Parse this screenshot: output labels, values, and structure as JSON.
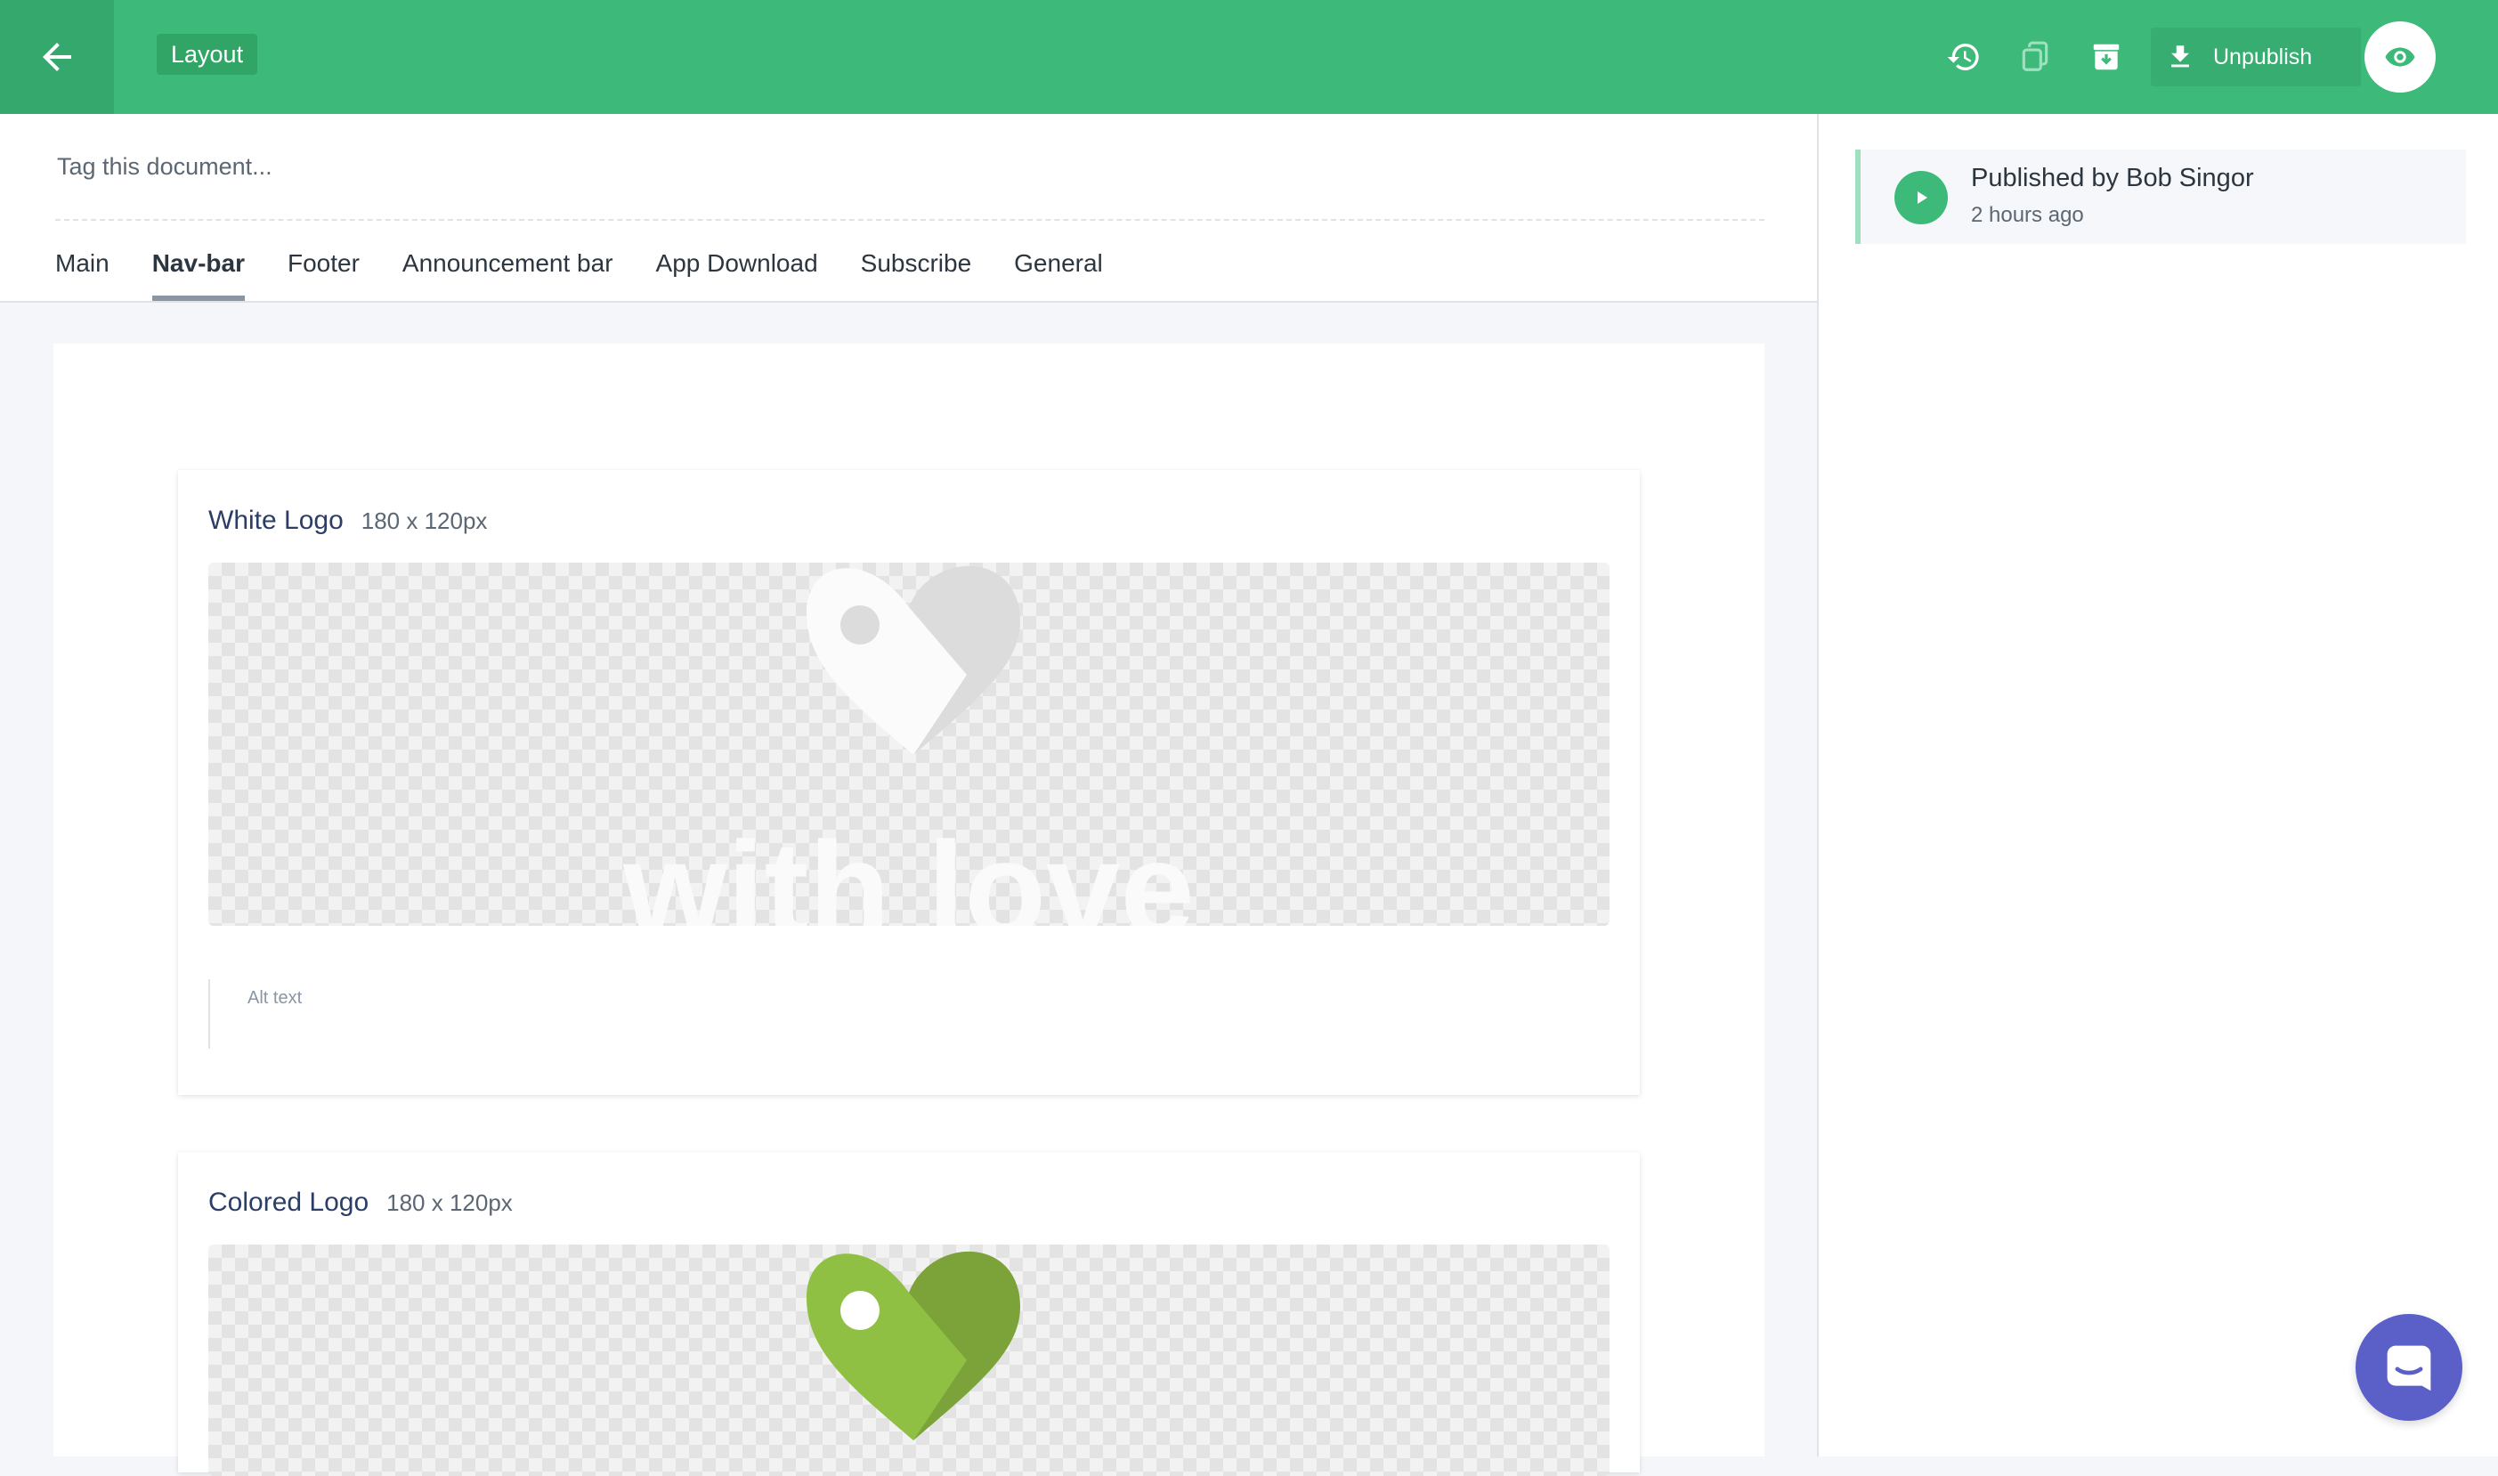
{
  "header": {
    "doc_type": "Layout",
    "actions": {
      "history_icon": "history-icon",
      "duplicate_icon": "copy-icon",
      "archive_icon": "archive-icon",
      "unpublish_label": "Unpublish",
      "preview_icon": "eye-icon"
    },
    "accent_color": "#3db97a"
  },
  "editor": {
    "tag_placeholder": "Tag this document...",
    "tabs": [
      "Main",
      "Nav-bar",
      "Footer",
      "Announcement bar",
      "App Download",
      "Subscribe",
      "General"
    ],
    "active_tab": "Nav-bar"
  },
  "fields": [
    {
      "title": "White Logo",
      "dims": "180 x 120px",
      "image_text": "with love",
      "alt_label": "Alt text"
    },
    {
      "title": "Colored Logo",
      "dims": "180 x 120px"
    }
  ],
  "status": {
    "title": "Published by Bob Singor",
    "time": "2 hours ago"
  },
  "chat": {
    "icon": "chat-icon"
  }
}
